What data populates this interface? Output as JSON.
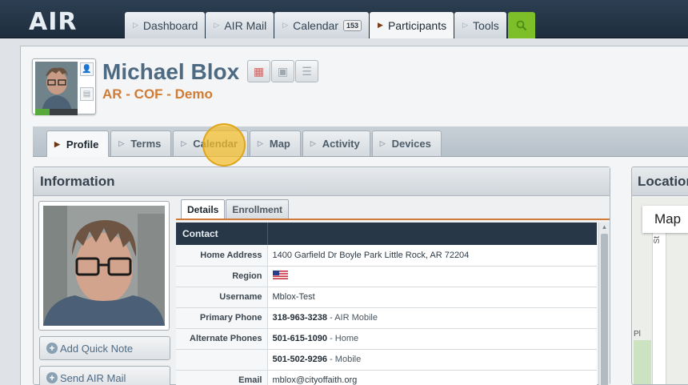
{
  "app": {
    "logo": "AIR"
  },
  "top_nav": {
    "tabs": [
      {
        "label": "Dashboard"
      },
      {
        "label": "AIR Mail"
      },
      {
        "label": "Calendar",
        "badge": "153"
      },
      {
        "label": "Participants",
        "active": true
      },
      {
        "label": "Tools"
      }
    ],
    "search_icon": "search-icon"
  },
  "participant": {
    "name": "Michael Blox",
    "subtitle": "AR - COF - Demo"
  },
  "profile_tabs": [
    {
      "label": "Profile",
      "active": true
    },
    {
      "label": "Terms"
    },
    {
      "label": "Calendar"
    },
    {
      "label": "Map"
    },
    {
      "label": "Activity"
    },
    {
      "label": "Devices"
    }
  ],
  "info": {
    "title": "Information",
    "buttons": {
      "quick_note": "Add Quick Note",
      "send_mail": "Send AIR Mail"
    },
    "detail_tabs": [
      {
        "label": "Details",
        "active": true
      },
      {
        "label": "Enrollment"
      }
    ],
    "section_header": "Contact",
    "rows": [
      {
        "label": "Home Address",
        "value": "1400 Garfield Dr Boyle Park Little Rock, AR 72204"
      },
      {
        "label": "Region",
        "value": "",
        "flag": "us-flag-icon"
      },
      {
        "label": "Username",
        "value": "Mblox-Test"
      },
      {
        "label": "Primary Phone",
        "value": "318-963-3238",
        "note": "- AIR Mobile"
      },
      {
        "label": "Alternate Phones",
        "value": "501-615-1090",
        "note": "- Home"
      },
      {
        "label": "",
        "value": "501-502-9296",
        "note": "- Mobile"
      },
      {
        "label": "Email",
        "value": "mblox@cityoffaith.org"
      }
    ]
  },
  "location": {
    "title": "Location",
    "map_button": "Map",
    "street_label": "St",
    "place_label": "Pl"
  },
  "colors": {
    "accent": "#d07c34",
    "name": "#4e6a82",
    "header_dark": "#273747",
    "search_green": "#7cbf28"
  }
}
